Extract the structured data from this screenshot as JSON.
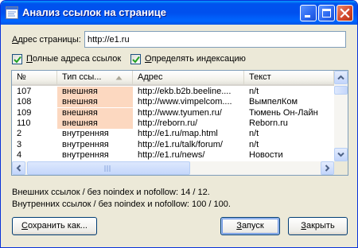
{
  "window": {
    "title": "Анализ ссылок на странице",
    "buttons": {
      "minimize": "minimize",
      "maximize": "maximize",
      "close": "close"
    }
  },
  "address": {
    "label_ul": "А",
    "label_rest": "дрес страницы:",
    "value": "http://e1.ru"
  },
  "options": {
    "full_urls": {
      "label_ul": "П",
      "label_rest": "олные адреса ссылок",
      "checked": true
    },
    "detect_indexing": {
      "label_ul": "О",
      "label_rest": "пределять индексацию",
      "checked": true
    }
  },
  "table": {
    "columns": [
      "№",
      "Тип ссы...",
      "Адрес",
      "Текст"
    ],
    "sort_column": "Тип ссы...",
    "rows": [
      {
        "num": "107",
        "type": "внешняя",
        "url": "http://ekb.b2b.beeline....",
        "text": "n/t",
        "highlight": true
      },
      {
        "num": "108",
        "type": "внешняя",
        "url": "http://www.vimpelcom....",
        "text": "ВымпелКом",
        "highlight": true
      },
      {
        "num": "109",
        "type": "внешняя",
        "url": "http://www.tyumen.ru/",
        "text": "Тюмень Он-Лайн",
        "highlight": true
      },
      {
        "num": "110",
        "type": "внешняя",
        "url": "http://reborn.ru/",
        "text": "Reborn.ru",
        "highlight": true
      },
      {
        "num": "2",
        "type": "внутренняя",
        "url": "http://e1.ru/map.html",
        "text": "n/t",
        "highlight": false
      },
      {
        "num": "3",
        "type": "внутренняя",
        "url": "http://e1.ru/talk/forum/",
        "text": "n/t",
        "highlight": false
      },
      {
        "num": "4",
        "type": "внутренняя",
        "url": "http://e1.ru/news/",
        "text": "Новости",
        "highlight": false
      }
    ]
  },
  "stats": {
    "external": "Внешних ссылок / без noindex и nofollow: 14 / 12.",
    "internal": "Внутренних ссылок / без noindex и nofollow: 100 / 100."
  },
  "buttons": {
    "save": {
      "ul": "С",
      "rest": "охранить как..."
    },
    "start": {
      "ul": "З",
      "rest": "апуск"
    },
    "close": {
      "ul": "З",
      "rest": "акрыть"
    }
  },
  "colors": {
    "highlight": "#fcd8c0",
    "title_bar": "#0054e3",
    "face": "#ece9d8"
  }
}
